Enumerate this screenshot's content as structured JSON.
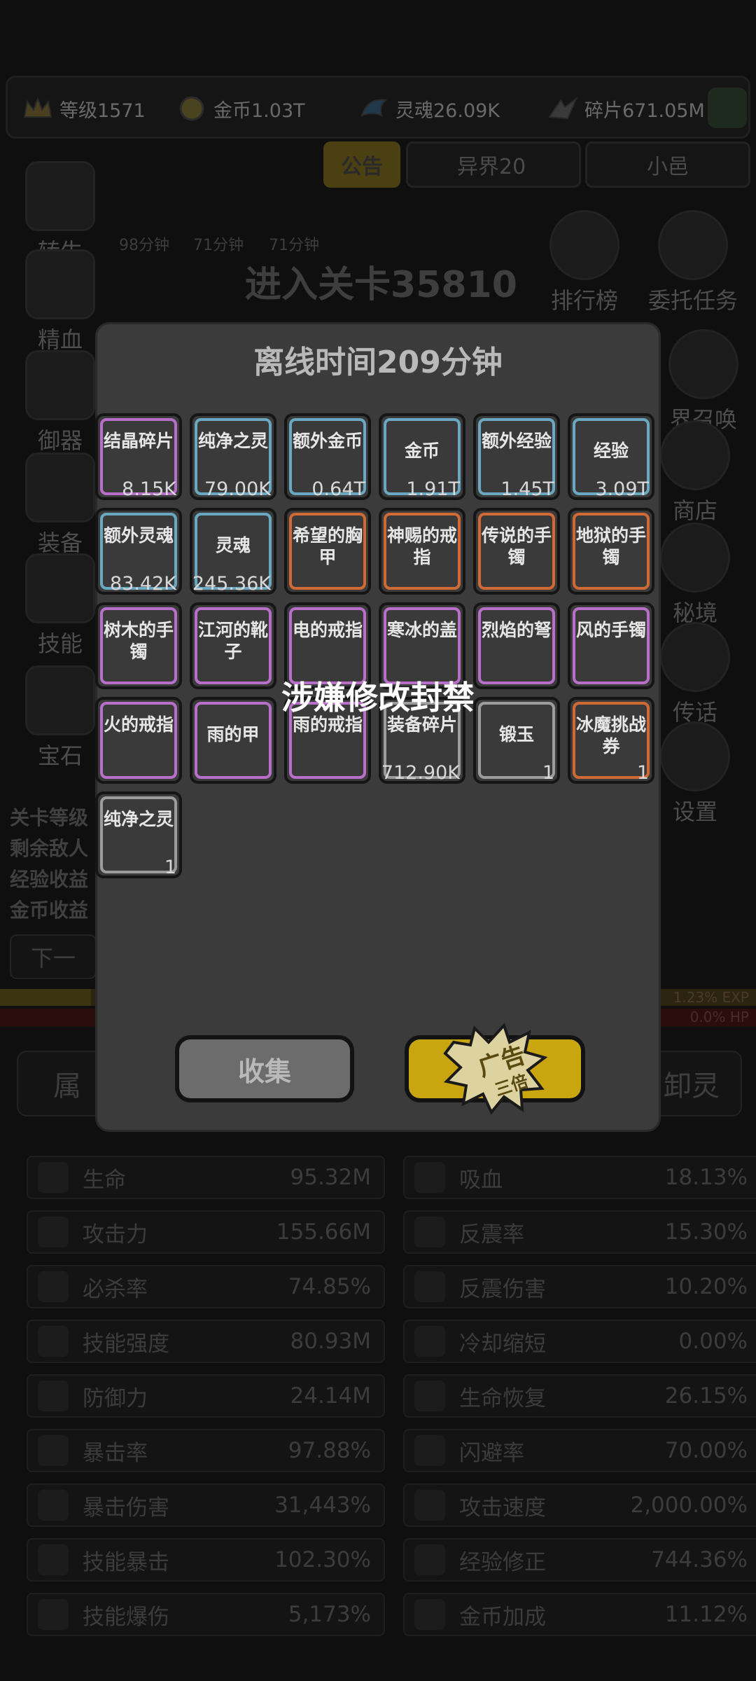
{
  "resources": [
    {
      "label": "等级1571",
      "icon": "crown-icon"
    },
    {
      "label": "金币1.03T",
      "icon": "coin-icon"
    },
    {
      "label": "灵魂26.09K",
      "icon": "soul-icon"
    },
    {
      "label": "碎片671.05M",
      "icon": "shard-icon"
    }
  ],
  "tabs": {
    "notice": "公告",
    "realm": "异界20",
    "small": "小邑"
  },
  "timers": [
    "98分钟",
    "71分钟",
    "71分钟"
  ],
  "stage_text": "进入关卡35810",
  "left_menu": [
    "转生",
    "精血",
    "御器",
    "装备",
    "技能",
    "宝石"
  ],
  "right_menu": [
    "排行榜",
    "委托任务",
    "界召唤",
    "商店",
    "秘境",
    "传话",
    "设置"
  ],
  "left_info": [
    "关卡等级",
    "剩余敌人",
    "经验收益",
    "金币收益"
  ],
  "left_button": "下一",
  "side_tabs": {
    "left": "属",
    "right": "卸灵"
  },
  "bars": {
    "exp": "1.23% EXP",
    "hp": "0.0% HP"
  },
  "stats_left": [
    {
      "name": "生命",
      "value": "95.32M",
      "icon": "sword-icon"
    },
    {
      "name": "攻击力",
      "value": "155.66M",
      "icon": "sword-icon"
    },
    {
      "name": "必杀率",
      "value": "74.85%",
      "icon": "crit-icon"
    },
    {
      "name": "技能强度",
      "value": "80.93M",
      "icon": "lightning-icon"
    },
    {
      "name": "防御力",
      "value": "24.14M",
      "icon": "shield-icon"
    },
    {
      "name": "暴击率",
      "value": "97.88%",
      "icon": "fire-icon"
    },
    {
      "name": "暴击伤害",
      "value": "31,443%",
      "icon": "fire-icon"
    },
    {
      "name": "技能暴击",
      "value": "102.30%",
      "icon": "blue-fire-icon"
    },
    {
      "name": "技能爆伤",
      "value": "5,173%",
      "icon": "blue-fire-icon"
    }
  ],
  "stats_right": [
    {
      "name": "吸血",
      "value": "18.13%",
      "icon": "bat-icon"
    },
    {
      "name": "反震率",
      "value": "15.30%",
      "icon": "spark-icon"
    },
    {
      "name": "反震伤害",
      "value": "10.20%",
      "icon": "spark-icon"
    },
    {
      "name": "冷却缩短",
      "value": "0.00%",
      "icon": "moon-icon"
    },
    {
      "name": "生命恢复",
      "value": "26.15%",
      "icon": "plus-icon"
    },
    {
      "name": "闪避率",
      "value": "70.00%",
      "icon": "dodge-icon"
    },
    {
      "name": "攻击速度",
      "value": "2,000.00%",
      "icon": "swords-icon"
    },
    {
      "name": "经验修正",
      "value": "744.36%",
      "icon": "crown-icon"
    },
    {
      "name": "金币加成",
      "value": "11.12%",
      "icon": "coin-icon"
    }
  ],
  "dialog": {
    "title": "离线时间209分钟",
    "items": [
      {
        "name": "结晶碎片",
        "count": "8.15K",
        "rarity": "purple"
      },
      {
        "name": "纯净之灵",
        "count": "79.00K",
        "rarity": "blue"
      },
      {
        "name": "额外金币",
        "count": "0.64T",
        "rarity": "blue"
      },
      {
        "name": "金币",
        "count": "1.91T",
        "rarity": "blue"
      },
      {
        "name": "额外经验",
        "count": "1.45T",
        "rarity": "blue"
      },
      {
        "name": "经验",
        "count": "3.09T",
        "rarity": "blue"
      },
      {
        "name": "额外灵魂",
        "count": "83.42K",
        "rarity": "blue"
      },
      {
        "name": "灵魂",
        "count": "245.36K",
        "rarity": "blue"
      },
      {
        "name": "希望的胸甲",
        "count": "",
        "rarity": "orange"
      },
      {
        "name": "神赐的戒指",
        "count": "",
        "rarity": "orange"
      },
      {
        "name": "传说的手镯",
        "count": "",
        "rarity": "orange"
      },
      {
        "name": "地狱的手镯",
        "count": "",
        "rarity": "orange"
      },
      {
        "name": "树木的手镯",
        "count": "",
        "rarity": "purple"
      },
      {
        "name": "江河的靴子",
        "count": "",
        "rarity": "purple"
      },
      {
        "name": "电的戒指",
        "count": "",
        "rarity": "purple"
      },
      {
        "name": "寒冰的盖",
        "count": "",
        "rarity": "purple"
      },
      {
        "name": "烈焰的弩",
        "count": "",
        "rarity": "purple"
      },
      {
        "name": "风的手镯",
        "count": "",
        "rarity": "purple"
      },
      {
        "name": "火的戒指",
        "count": "",
        "rarity": "purple"
      },
      {
        "name": "雨的甲",
        "count": "",
        "rarity": "purple"
      },
      {
        "name": "雨的戒指",
        "count": "",
        "rarity": "purple"
      },
      {
        "name": "装备碎片",
        "count": "712.90K",
        "rarity": "gray"
      },
      {
        "name": "锻玉",
        "count": "1",
        "rarity": "gray"
      },
      {
        "name": "冰魔挑战券",
        "count": "1",
        "rarity": "orange"
      },
      {
        "name": "纯净之灵",
        "count": "1",
        "rarity": "gray"
      }
    ],
    "banned_text": "涉嫌修改封禁",
    "collect_label": "收集",
    "ad_label": "广告",
    "ad_sub": "三倍"
  }
}
